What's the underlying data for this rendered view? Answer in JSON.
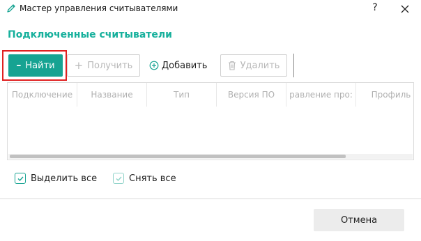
{
  "window": {
    "title": "Мастер управления считывателями",
    "help_label": "?"
  },
  "section": {
    "title": "Подключенные считыватели"
  },
  "toolbar": {
    "find_label": "Найти",
    "get_label": "Получить",
    "add_label": "Добавить",
    "delete_label": "Удалить"
  },
  "table": {
    "columns": [
      "Подключение",
      "Название",
      "Тип",
      "Версия ПО",
      "равление про:",
      "Профиль"
    ],
    "rows": []
  },
  "checks": {
    "select_all_label": "Выделить все",
    "deselect_all_label": "Снять все"
  },
  "footer": {
    "cancel_label": "Отмена"
  },
  "colors": {
    "accent": "#16a392",
    "title_accent": "#16b09c",
    "highlight_frame": "#e02020"
  }
}
